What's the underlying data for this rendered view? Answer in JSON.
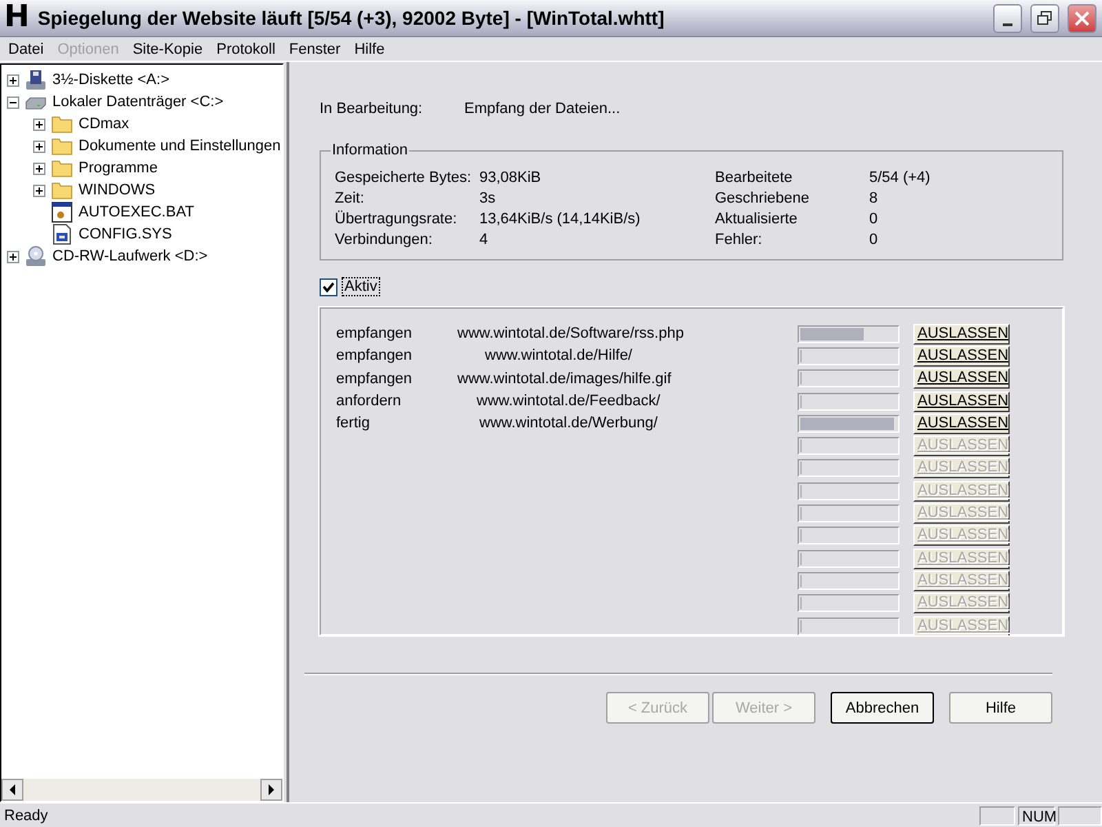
{
  "window": {
    "app_icon": "H",
    "title": "Spiegelung der Website läuft [5/54 (+3), 92002 Byte] - [WinTotal.whtt]"
  },
  "menu": [
    {
      "label": "Datei",
      "disabled": false
    },
    {
      "label": "Optionen",
      "disabled": true
    },
    {
      "label": "Site-Kopie",
      "disabled": false
    },
    {
      "label": "Protokoll",
      "disabled": false
    },
    {
      "label": "Fenster",
      "disabled": false
    },
    {
      "label": "Hilfe",
      "disabled": false
    }
  ],
  "tree": [
    {
      "label": "3½-Diskette <A:>",
      "kind": "floppy",
      "expanded": false
    },
    {
      "label": "Lokaler Datenträger <C:>",
      "kind": "disk",
      "expanded": true,
      "children": [
        {
          "label": "CDmax",
          "kind": "folder",
          "expanded": false
        },
        {
          "label": "Dokumente und Einstellungen",
          "kind": "folder",
          "expanded": false
        },
        {
          "label": "Programme",
          "kind": "folder",
          "expanded": false
        },
        {
          "label": "WINDOWS",
          "kind": "folder",
          "expanded": false
        },
        {
          "label": "AUTOEXEC.BAT",
          "kind": "batch"
        },
        {
          "label": "CONFIG.SYS",
          "kind": "config"
        }
      ]
    },
    {
      "label": "CD-RW-Laufwerk <D:>",
      "kind": "cd",
      "expanded": false
    }
  ],
  "progress": {
    "label": "In Bearbeitung:",
    "value": "Empfang der Dateien..."
  },
  "information": {
    "title": "Information",
    "left": [
      {
        "label": "Gespeicherte Bytes:",
        "value": "93,08KiB"
      },
      {
        "label": "Zeit:",
        "value": "3s"
      },
      {
        "label": "Übertragungsrate:",
        "value": "13,64KiB/s (14,14KiB/s)"
      },
      {
        "label": "Verbindungen:",
        "value": "4"
      }
    ],
    "right": [
      {
        "label": "Bearbeitete",
        "value": "5/54 (+4)"
      },
      {
        "label": "Geschriebene",
        "value": "8"
      },
      {
        "label": "Aktualisierte",
        "value": "0"
      },
      {
        "label": "Fehler:",
        "value": "0"
      }
    ]
  },
  "active": {
    "label": "Aktiv",
    "checked": true
  },
  "transfers": [
    {
      "status": "empfangen",
      "url": "www.wintotal.de/Software/rss.php",
      "level": 0.65,
      "skip": "AUSLASSEN",
      "disabled": false
    },
    {
      "status": "empfangen",
      "url": "www.wintotal.de/Hilfe/",
      "level": 0,
      "skip": "AUSLASSEN",
      "disabled": false
    },
    {
      "status": "empfangen",
      "url": "www.wintotal.de/images/hilfe.gif",
      "level": 0,
      "skip": "AUSLASSEN",
      "disabled": false
    },
    {
      "status": "anfordern",
      "url": "www.wintotal.de/Feedback/",
      "level": 0,
      "skip": "AUSLASSEN",
      "disabled": false
    },
    {
      "status": "fertig",
      "url": "www.wintotal.de/Werbung/",
      "level": 0.97,
      "skip": "AUSLASSEN",
      "disabled": false
    },
    {
      "level": 0,
      "skip": "AUSLASSEN",
      "disabled": true
    },
    {
      "level": 0,
      "skip": "AUSLASSEN",
      "disabled": true
    },
    {
      "level": 0,
      "skip": "AUSLASSEN",
      "disabled": true
    },
    {
      "level": 0,
      "skip": "AUSLASSEN",
      "disabled": true
    },
    {
      "level": 0,
      "skip": "AUSLASSEN",
      "disabled": true
    },
    {
      "level": 0,
      "skip": "AUSLASSEN",
      "disabled": true
    },
    {
      "level": 0,
      "skip": "AUSLASSEN",
      "disabled": true
    },
    {
      "level": 0,
      "skip": "AUSLASSEN",
      "disabled": true
    },
    {
      "level": 0,
      "skip": "AUSLASSEN",
      "disabled": true
    }
  ],
  "buttons": [
    {
      "label": "< Zurück",
      "disabled": true,
      "focused": false
    },
    {
      "label": "Weiter >",
      "disabled": true,
      "focused": false
    },
    {
      "label": "Abbrechen",
      "disabled": false,
      "focused": true
    },
    {
      "label": "Hilfe",
      "disabled": false,
      "focused": false
    }
  ],
  "status_bar": {
    "text": "Ready",
    "num_lock": "NUM"
  }
}
